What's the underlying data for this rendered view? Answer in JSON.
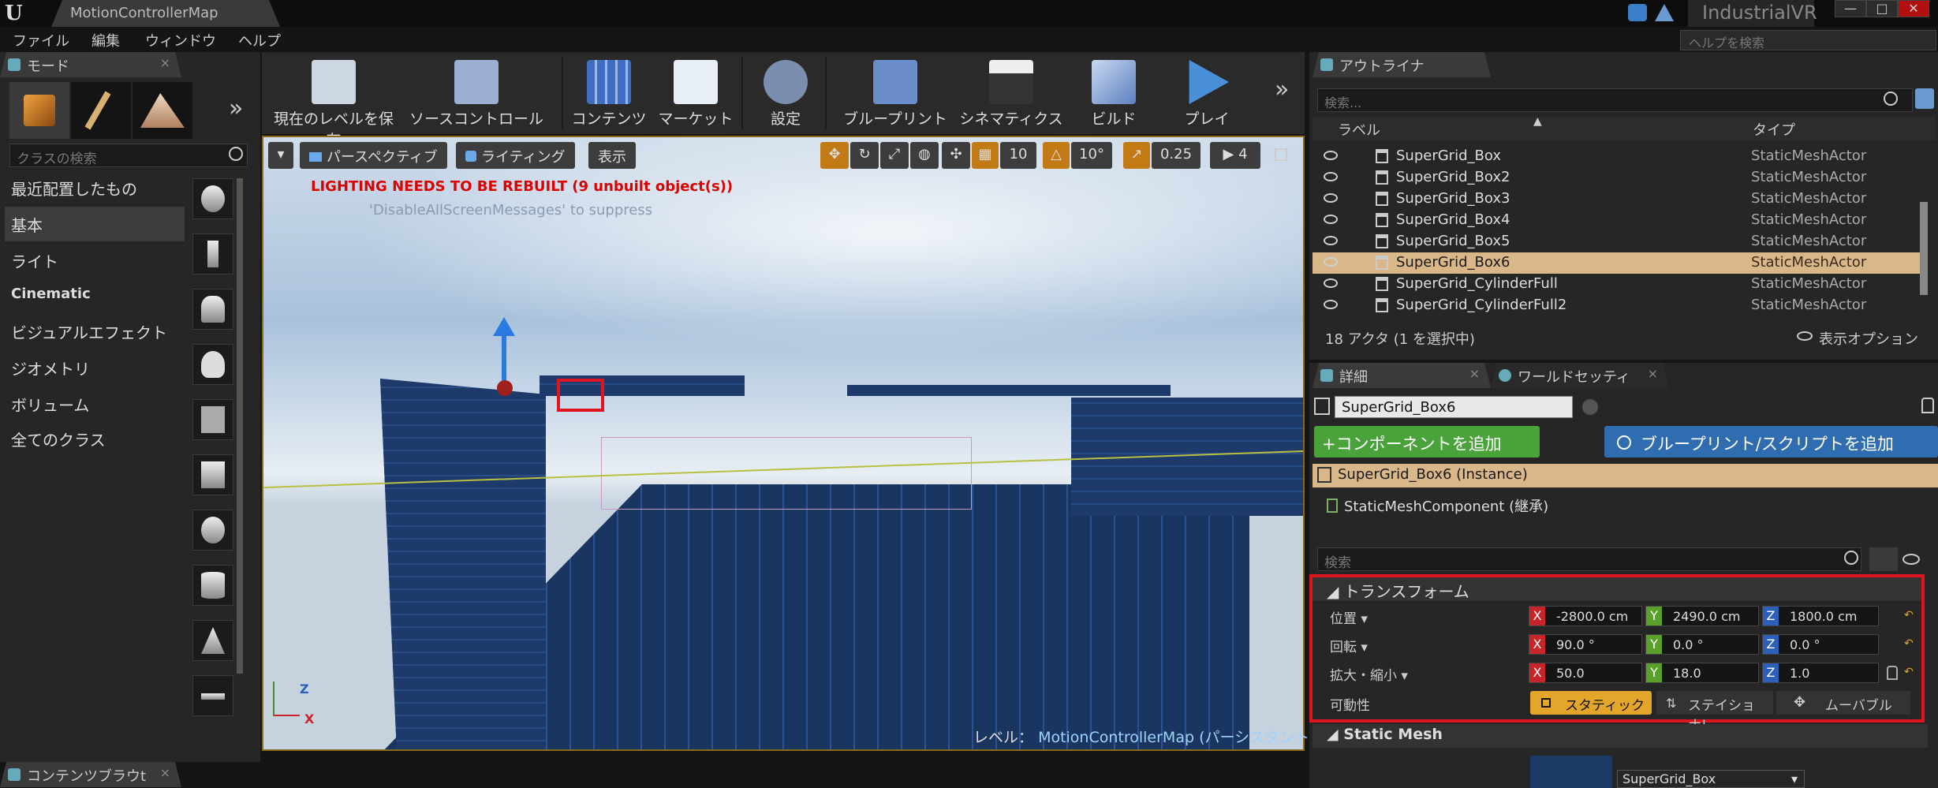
{
  "window": {
    "tab_title": "MotionControllerMap",
    "project": "IndustrialVR",
    "help_search_placeholder": "ヘルプを検索",
    "min_label": "—",
    "max_label": "□",
    "close_label": "✕"
  },
  "menu": [
    "ファイル",
    "編集",
    "ウィンドウ",
    "ヘルプ"
  ],
  "modes": {
    "tab": "モード",
    "class_search_placeholder": "クラスの検索",
    "expand_label": "»",
    "categories": [
      "最近配置したもの",
      "基本",
      "ライト",
      "Cinematic",
      "ビジュアルエフェクト",
      "ジオメトリ",
      "ボリューム",
      "全てのクラス"
    ]
  },
  "toolbar": {
    "items": [
      "現在のレベルを保存",
      "ソースコントロール",
      "コンテンツ",
      "マーケット",
      "設定",
      "ブループリント",
      "シネマティクス",
      "ビルド",
      "プレイ"
    ],
    "more_label": "»"
  },
  "viewport": {
    "dropdown": "▾",
    "perspective": "パースペクティブ",
    "lighting": "ライティング",
    "show": "表示",
    "grid_snap": "10",
    "rot_snap": "10°",
    "scale_snap": "0.25",
    "cam_speed": "4",
    "warning": "LIGHTING NEEDS TO BE REBUILT (9 unbuilt object(s))",
    "suppress": "'DisableAllScreenMessages' to suppress",
    "level_prefix": "レベル：",
    "level_name": "MotionControllerMap (パーシスタント)",
    "axis_z": "Z",
    "axis_x": "X"
  },
  "outliner": {
    "tab": "アウトライナ",
    "search_placeholder": "検索...",
    "col_label": "ラベル",
    "col_type": "タイプ",
    "rows": [
      {
        "name": "SuperGrid_Box",
        "type": "StaticMeshActor"
      },
      {
        "name": "SuperGrid_Box2",
        "type": "StaticMeshActor"
      },
      {
        "name": "SuperGrid_Box3",
        "type": "StaticMeshActor"
      },
      {
        "name": "SuperGrid_Box4",
        "type": "StaticMeshActor"
      },
      {
        "name": "SuperGrid_Box5",
        "type": "StaticMeshActor"
      },
      {
        "name": "SuperGrid_Box6",
        "type": "StaticMeshActor"
      },
      {
        "name": "SuperGrid_CylinderFull",
        "type": "StaticMeshActor"
      },
      {
        "name": "SuperGrid_CylinderFull2",
        "type": "StaticMeshActor"
      }
    ],
    "selected_index": 5,
    "count": "18 アクタ (1 を選択中)",
    "view_options": "表示オプション"
  },
  "details": {
    "tab": "詳細",
    "tab2": "ワールドセッティ",
    "object_name": "SuperGrid_Box6",
    "add_component": "+コンポーネントを追加",
    "add_blueprint": "ブループリント/スクリプトを追加",
    "instance": "SuperGrid_Box6 (Instance)",
    "component": "StaticMeshComponent (継承)",
    "search_placeholder": "検索",
    "transform_header": "トランスフォーム",
    "location_label": "位置",
    "rotation_label": "回転",
    "scale_label": "拡大・縮小",
    "mobility_label": "可動性",
    "axis_x": "X",
    "axis_y": "Y",
    "axis_z": "Z",
    "location": {
      "x": "-2800.0 cm",
      "y": "2490.0 cm",
      "z": "1800.0 cm"
    },
    "rotation": {
      "x": "90.0 °",
      "y": "0.0 °",
      "z": "0.0 °"
    },
    "scale": {
      "x": "50.0",
      "y": "18.0",
      "z": "1.0"
    },
    "mobility_options": [
      "スタティック",
      "ステイショナ!",
      "ムーバブル"
    ],
    "static_mesh_header": "Static Mesh",
    "static_mesh_value": "SuperGrid_Box"
  },
  "bottom": {
    "content_browser_tab": "コンテンツブラウt"
  },
  "colors": {
    "accent_orange": "#c17a14",
    "selection": "#d9b789",
    "highlight_red": "#e0141e",
    "add_green": "#49a23a",
    "add_blue": "#2f6db0"
  }
}
